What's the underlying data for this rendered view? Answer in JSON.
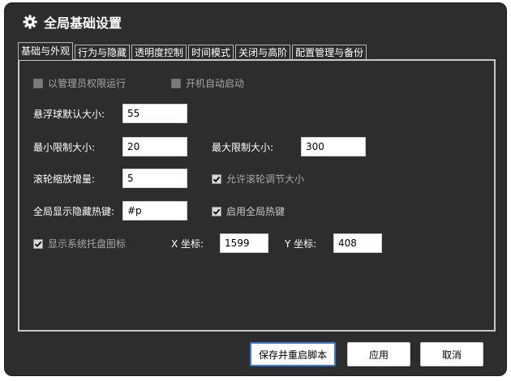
{
  "window": {
    "title": "全局基础设置",
    "icon": "gear-icon"
  },
  "tabs": [
    {
      "label": "基础与外观",
      "active": true
    },
    {
      "label": "行为与隐藏"
    },
    {
      "label": "透明度控制"
    },
    {
      "label": "时间模式"
    },
    {
      "label": "关闭与高阶"
    },
    {
      "label": "配置管理与备份"
    }
  ],
  "options": {
    "run_as_admin": {
      "label": "以管理员权限运行",
      "checked": false
    },
    "autostart": {
      "label": "开机自动启动",
      "checked": false
    },
    "allow_wheel_resize": {
      "label": "允许滚轮调节大小",
      "checked": true
    },
    "enable_hotkey": {
      "label": "启用全局热键",
      "checked": true
    },
    "show_tray_icon": {
      "label": "显示系统托盘图标",
      "checked": true
    }
  },
  "fields": {
    "default_size": {
      "label": "悬浮球默认大小:",
      "value": "55"
    },
    "min_size": {
      "label": "最小限制大小:",
      "value": "20"
    },
    "max_size": {
      "label": "最大限制大小:",
      "value": "300"
    },
    "wheel_step": {
      "label": "滚轮缩放增量:",
      "value": "5"
    },
    "hotkey": {
      "label": "全局显示隐藏热键:",
      "value": "#p"
    },
    "x_coord": {
      "label": "X 坐标:",
      "value": "1599"
    },
    "y_coord": {
      "label": "Y 坐标:",
      "value": "408"
    }
  },
  "buttons": {
    "save_restart": "保存并重启脚本",
    "apply": "应用",
    "cancel": "取消"
  }
}
